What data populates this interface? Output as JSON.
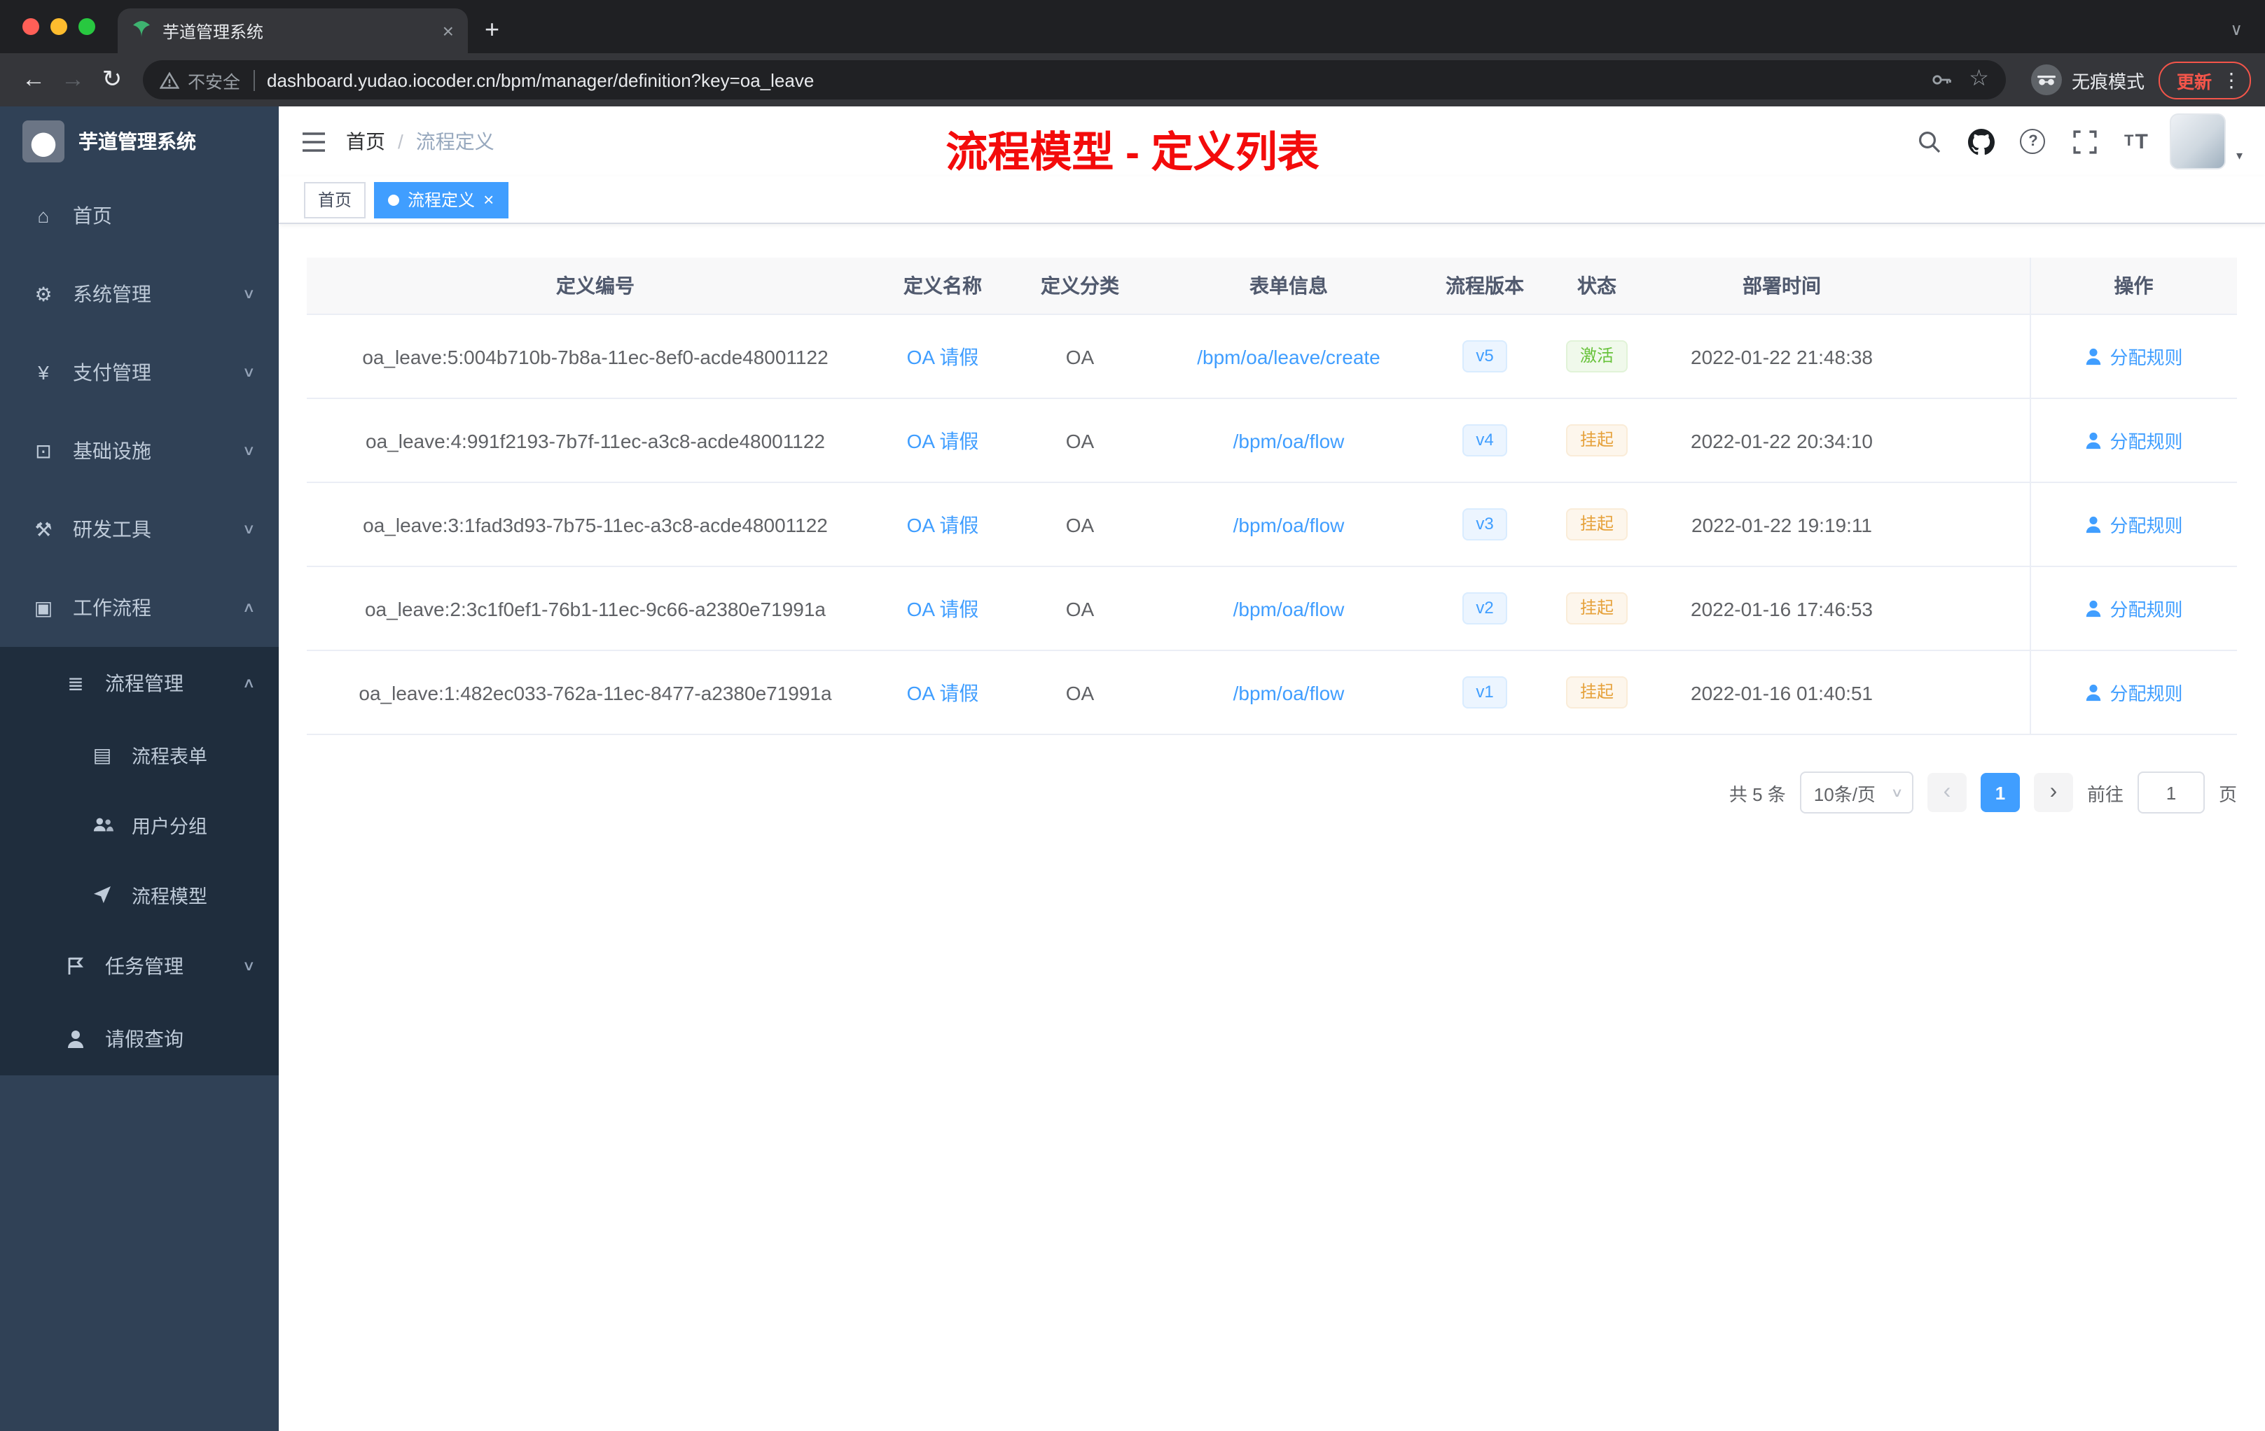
{
  "browser": {
    "tab_title": "芋道管理系统",
    "security_label": "不安全",
    "url": "dashboard.yudao.iocoder.cn/bpm/manager/definition?key=oa_leave",
    "incognito_label": "无痕模式",
    "update_label": "更新"
  },
  "sidebar": {
    "logo_title": "芋道管理系统",
    "menu": [
      {
        "label": "首页"
      },
      {
        "label": "系统管理"
      },
      {
        "label": "支付管理"
      },
      {
        "label": "基础设施"
      },
      {
        "label": "研发工具"
      },
      {
        "label": "工作流程"
      }
    ],
    "process_mgmt": {
      "label": "流程管理"
    },
    "process_children": [
      {
        "label": "流程表单"
      },
      {
        "label": "用户分组"
      },
      {
        "label": "流程模型"
      }
    ],
    "task_mgmt": {
      "label": "任务管理"
    },
    "leave_query": {
      "label": "请假查询"
    }
  },
  "header": {
    "breadcrumb": [
      "首页",
      "流程定义"
    ],
    "annotation": "流程模型 - 定义列表"
  },
  "tags": [
    {
      "label": "首页"
    },
    {
      "label": "流程定义"
    }
  ],
  "table": {
    "columns": [
      "定义编号",
      "定义名称",
      "定义分类",
      "表单信息",
      "流程版本",
      "状态",
      "部署时间",
      "操作"
    ],
    "rows": [
      {
        "id": "oa_leave:5:004b710b-7b8a-11ec-8ef0-acde48001122",
        "name": "OA 请假",
        "category": "OA",
        "form": "/bpm/oa/leave/create",
        "version": "v5",
        "status": "激活",
        "status_class": "tag-success",
        "time": "2022-01-22 21:48:38",
        "action": "分配规则"
      },
      {
        "id": "oa_leave:4:991f2193-7b7f-11ec-a3c8-acde48001122",
        "name": "OA 请假",
        "category": "OA",
        "form": "/bpm/oa/flow",
        "version": "v4",
        "status": "挂起",
        "status_class": "tag-warning",
        "time": "2022-01-22 20:34:10",
        "action": "分配规则"
      },
      {
        "id": "oa_leave:3:1fad3d93-7b75-11ec-a3c8-acde48001122",
        "name": "OA 请假",
        "category": "OA",
        "form": "/bpm/oa/flow",
        "version": "v3",
        "status": "挂起",
        "status_class": "tag-warning",
        "time": "2022-01-22 19:19:11",
        "action": "分配规则"
      },
      {
        "id": "oa_leave:2:3c1f0ef1-76b1-11ec-9c66-a2380e71991a",
        "name": "OA 请假",
        "category": "OA",
        "form": "/bpm/oa/flow",
        "version": "v2",
        "status": "挂起",
        "status_class": "tag-warning",
        "time": "2022-01-16 17:46:53",
        "action": "分配规则"
      },
      {
        "id": "oa_leave:1:482ec033-762a-11ec-8477-a2380e71991a",
        "name": "OA 请假",
        "category": "OA",
        "form": "/bpm/oa/flow",
        "version": "v1",
        "status": "挂起",
        "status_class": "tag-warning",
        "time": "2022-01-16 01:40:51",
        "action": "分配规则"
      }
    ]
  },
  "pagination": {
    "total_label": "共 5 条",
    "page_size_label": "10条/页",
    "prev_icon": "‹",
    "current_page": "1",
    "next_icon": "›",
    "goto_label": "前往",
    "goto_value": "1",
    "unit_label": "页"
  }
}
